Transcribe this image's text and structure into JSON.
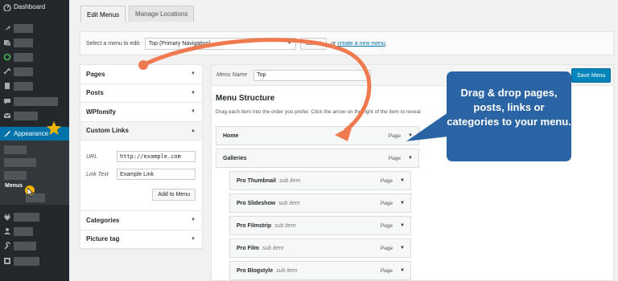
{
  "sidebar": {
    "dashboard_label": "Dashboard",
    "appearance_label": "Appearance",
    "menus_label": "Menus"
  },
  "tabs": {
    "edit_menus": "Edit Menus",
    "manage_locations": "Manage Locations"
  },
  "select_bar": {
    "label": "Select a menu to edit:",
    "selected": "Top (Primary Navigation)",
    "select_button": "Select",
    "or_text": "or",
    "create_link": "create a new menu",
    "period": "."
  },
  "accordion": {
    "sections": [
      "Pages",
      "Posts",
      "WPfomify",
      "Custom Links",
      "Categories",
      "Picture tag"
    ],
    "custom_links": {
      "url_label": "URL",
      "url_value": "http://example.com",
      "link_text_label": "Link Text",
      "link_text_value": "Example Link",
      "add_button": "Add to Menu"
    }
  },
  "menu": {
    "name_label": "Menu Name",
    "name_value": "Top",
    "save_button": "Save Menu",
    "structure_title": "Menu Structure",
    "structure_desc": "Drag each item into the order you prefer. Click the arrow on the right of the item to reveal",
    "items": [
      {
        "title": "Home",
        "sub": "",
        "type": "Page"
      },
      {
        "title": "Galleries",
        "sub": "",
        "type": "Page"
      },
      {
        "title": "Pro Thumbnail",
        "sub": "sub item",
        "type": "Page"
      },
      {
        "title": "Pro Slideshow",
        "sub": "sub item",
        "type": "Page"
      },
      {
        "title": "Pro Filmstrip",
        "sub": "sub item",
        "type": "Page"
      },
      {
        "title": "Pro Film",
        "sub": "sub item",
        "type": "Page"
      },
      {
        "title": "Pro Blogstyle",
        "sub": "sub item",
        "type": "Page"
      }
    ]
  },
  "callout": {
    "text": "Drag & drop pages, posts, links or categories to your menu."
  },
  "colors": {
    "sidebar": "#23282d",
    "accent": "#0073aa",
    "callout": "#2a64a5",
    "arrow": "#f07a4f",
    "star": "#f0b400"
  }
}
